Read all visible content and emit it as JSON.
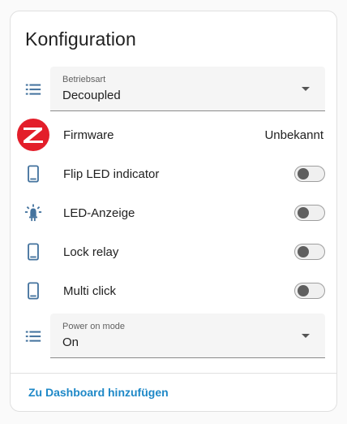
{
  "card": {
    "title": "Konfiguration",
    "action_label": "Zu Dashboard hinzufügen"
  },
  "colors": {
    "icon": "#44739e",
    "zigbee_red": "#e31e2a",
    "link": "#1e88c7"
  },
  "rows": [
    {
      "type": "select",
      "icon": "list-icon",
      "label": "Betriebsart",
      "value": "Decoupled"
    },
    {
      "type": "info",
      "icon": "zigbee-icon",
      "label": "Firmware",
      "value": "Unbekannt"
    },
    {
      "type": "toggle",
      "icon": "device-icon",
      "label": "Flip LED indicator",
      "checked": false
    },
    {
      "type": "toggle",
      "icon": "led-icon",
      "label": "LED-Anzeige",
      "checked": false
    },
    {
      "type": "toggle",
      "icon": "device-icon",
      "label": "Lock relay",
      "checked": false
    },
    {
      "type": "toggle",
      "icon": "device-icon",
      "label": "Multi click",
      "checked": false
    },
    {
      "type": "select",
      "icon": "list-icon",
      "label": "Power on mode",
      "value": "On"
    }
  ]
}
